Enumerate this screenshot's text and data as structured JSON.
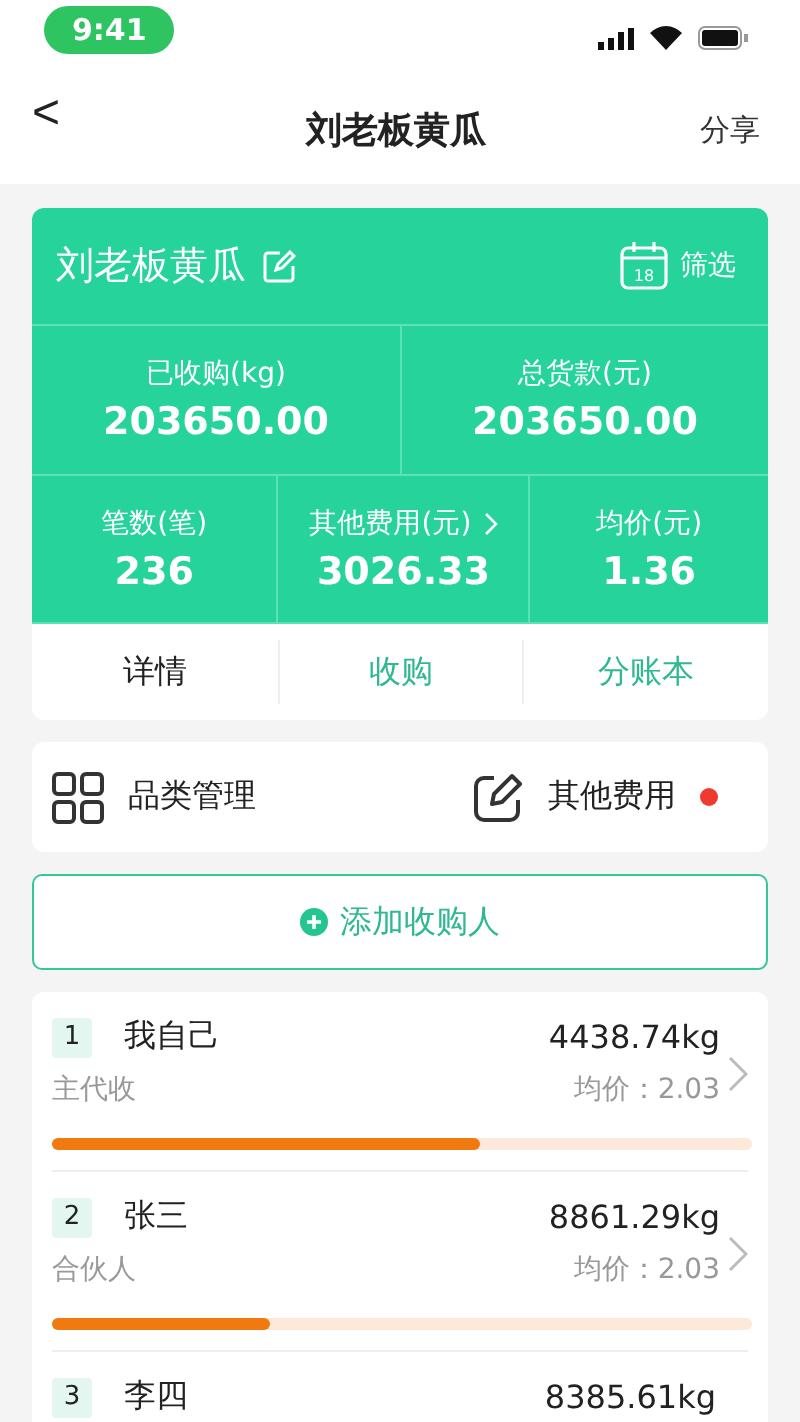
{
  "status_bar": {
    "time": "9:41"
  },
  "nav": {
    "back": "<",
    "title": "刘老板黄瓜",
    "action": "分享"
  },
  "summary": {
    "title": "刘老板黄瓜",
    "filter": "筛选",
    "calendar_day": "18",
    "stats_top": [
      {
        "label": "已收购(kg)",
        "value": "203650.00"
      },
      {
        "label": "总货款(元)",
        "value": "203650.00"
      }
    ],
    "stats_bottom": [
      {
        "label": "笔数(笔)",
        "value": "236",
        "link": false
      },
      {
        "label": "其他费用(元)",
        "value": "3026.33",
        "link": true
      },
      {
        "label": "均价(元)",
        "value": "1.36",
        "link": false
      }
    ],
    "tabs": [
      {
        "label": "详情",
        "selected": true
      },
      {
        "label": "收购",
        "selected": false
      },
      {
        "label": "分账本",
        "selected": false
      }
    ]
  },
  "quick_actions": [
    {
      "kind": "grid",
      "label": "品类管理",
      "badge": false
    },
    {
      "kind": "edit",
      "label": "其他费用",
      "badge": true
    }
  ],
  "add_button": "添加收购人",
  "buyers": [
    {
      "index": "1",
      "name": "我自己",
      "amount": "4438.74kg",
      "role": "主代收",
      "price": "均价：2.03",
      "level": 0.61
    },
    {
      "index": "2",
      "name": "张三",
      "amount": "8861.29kg",
      "role": "合伙人",
      "price": "均价：2.03",
      "level": 0.31
    },
    {
      "index": "3",
      "name": "李四",
      "amount": "8385.61kg"
    }
  ]
}
